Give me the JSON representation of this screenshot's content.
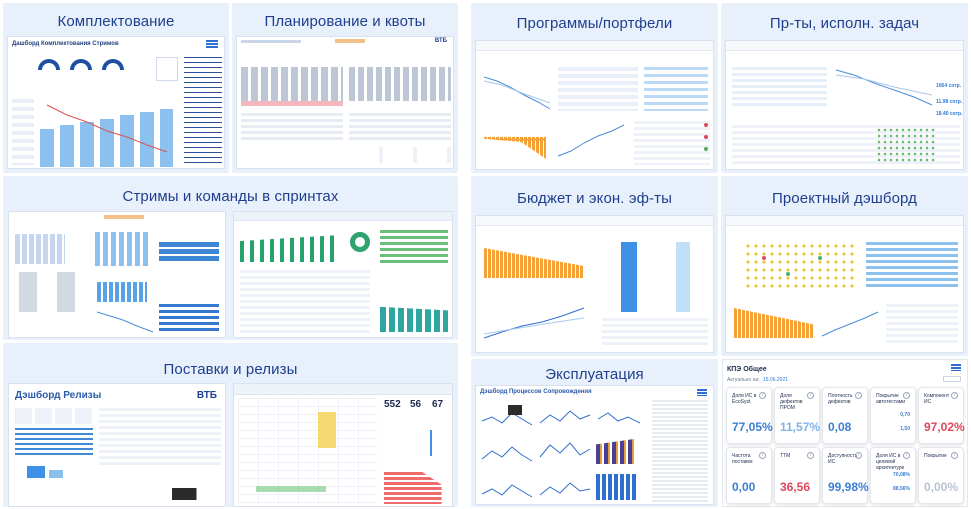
{
  "tiles": {
    "t1": {
      "title": "Комплектование",
      "dash_title": "Дашборд Комплектования Стримов"
    },
    "t2": {
      "title": "Планирование и квоты",
      "brand": "ВТБ"
    },
    "t3": {
      "title": "Программы/портфели"
    },
    "t4": {
      "title": "Пр-ты, исполн. задач",
      "values": [
        "1064 сотр.",
        "11.98 сотр.",
        "18.40 сотр."
      ]
    },
    "t5": {
      "title": "Стримы и команды в спринтах"
    },
    "t6": {
      "title": "Бюджет и экон. эф-ты"
    },
    "t7": {
      "title": "Проектный дэшборд"
    },
    "t8": {
      "title": "Поставки и релизы",
      "dash_title": "Дэшборд Релизы",
      "brand": "ВТБ",
      "nums": [
        "552",
        "56",
        "67"
      ]
    },
    "t9": {
      "title": "Эксплуатация",
      "dash_title": "Дэшборд Процессов Сопровождения"
    },
    "t10": {
      "title": "КПЭ Общее",
      "date_label": "Актуально на:",
      "date": "15.06.2021",
      "cards": [
        {
          "label": "Доля ИС в EcoSyst",
          "value": "77,05%",
          "color": "#3b7fd4"
        },
        {
          "label": "Доля дефектов ПРОМ",
          "value": "11,57%",
          "color": "#7fb4e6"
        },
        {
          "label": "Плотность дефектов",
          "value": "0,08",
          "color": "#3b7fd4"
        },
        {
          "label": "Покрытие автотестами",
          "value": "",
          "color": "#3b7fd4"
        },
        {
          "label": "Компонент ИС",
          "value": "97,02%",
          "color": "#e0475b"
        },
        {
          "label": "Частота поставок",
          "value": "0,00",
          "color": "#3b7fd4"
        },
        {
          "label": "TTM",
          "value": "36,56",
          "color": "#e0475b"
        },
        {
          "label": "Доступность ИС",
          "value": "99,98%",
          "color": "#3b7fd4"
        },
        {
          "label": "Доля ИС в целевой архитектуре",
          "value": "",
          "color": "#3b7fd4"
        },
        {
          "label": "Покрытие",
          "value": "0,00%",
          "color": "#b9c2d2"
        }
      ],
      "mini": {
        "a": "0,70",
        "b": "1,50",
        "c": "70,08%",
        "d": "88,56%"
      }
    }
  }
}
